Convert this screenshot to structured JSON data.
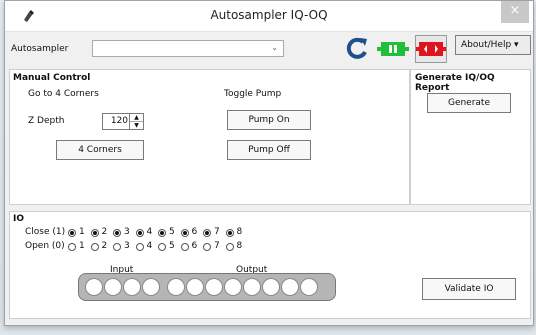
{
  "window": {
    "title": "Autosampler IQ-OQ",
    "close_glyph": "×"
  },
  "toolbar": {
    "autosampler_label": "Autosampler",
    "autosampler_value": "",
    "about_label": "About/Help ▾",
    "refresh_icon": "refresh-icon",
    "connect_icon": "plug-connect-icon",
    "disconnect_icon": "plug-disconnect-icon",
    "colors": {
      "refresh": "#1e4e8c",
      "connect": "#1fbf3a",
      "disconnect": "#e0141e"
    }
  },
  "manual": {
    "title": "Manual Control",
    "corners_heading": "Go to 4 Corners",
    "pump_heading": "Toggle Pump",
    "zdepth_label": "Z Depth",
    "zdepth_value": "120",
    "corners_button": "4 Corners",
    "pump_on_button": "Pump On",
    "pump_off_button": "Pump Off"
  },
  "report": {
    "title": "Generate IQ/OQ Report",
    "generate_button": "Generate"
  },
  "io": {
    "title": "IO",
    "close_label": "Close (1)",
    "open_label": "Open (0)",
    "channels": [
      "1",
      "2",
      "3",
      "4",
      "5",
      "6",
      "7",
      "8"
    ],
    "close_checked": [
      true,
      true,
      true,
      true,
      true,
      true,
      true,
      true
    ],
    "open_checked": [
      false,
      false,
      false,
      false,
      false,
      false,
      false,
      false
    ],
    "input_label": "Input",
    "output_label": "Output",
    "validate_button": "Validate IO"
  }
}
